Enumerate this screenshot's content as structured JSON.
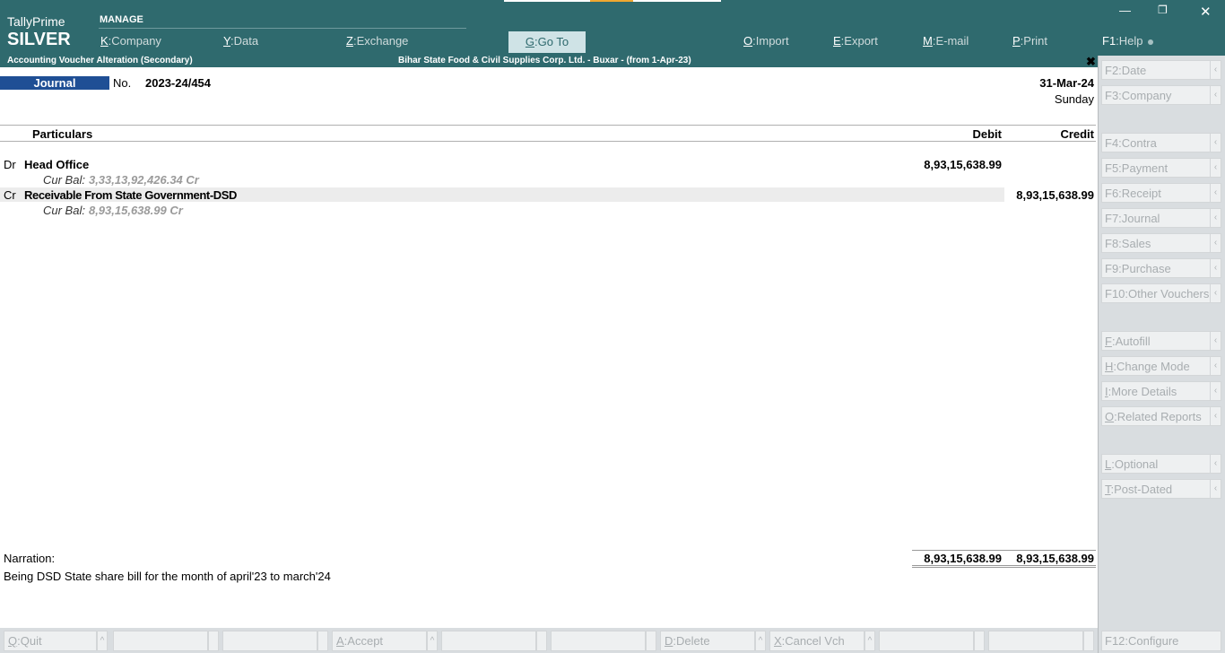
{
  "brand": {
    "name": "TallyPrime",
    "edition": "SILVER"
  },
  "menu": {
    "title": "MANAGE",
    "company": {
      "key": "K",
      "label": "Company"
    },
    "data": {
      "key": "Y",
      "label": "Data"
    },
    "exchange": {
      "key": "Z",
      "label": "Exchange"
    },
    "goto": {
      "key": "G",
      "label": "Go To"
    },
    "import": {
      "key": "O",
      "label": "Import"
    },
    "export": {
      "key": "E",
      "label": "Export"
    },
    "email": {
      "key": "M",
      "label": "E-mail"
    },
    "print": {
      "key": "P",
      "label": "Print"
    },
    "help": {
      "key": "F1",
      "label": "Help"
    }
  },
  "subtitle": {
    "screen": "Accounting Voucher Alteration (Secondary)",
    "company": "Bihar State Food & Civil Supplies Corp. Ltd. - Buxar - (from 1-Apr-23)"
  },
  "voucher": {
    "type": "Journal",
    "no_label": "No.",
    "no": "2023-24/454",
    "date": "31-Mar-24",
    "day": "Sunday"
  },
  "table": {
    "col_particulars": "Particulars",
    "col_debit": "Debit",
    "col_credit": "Credit",
    "bal_label": "Cur Bal:",
    "rows": [
      {
        "side": "Dr",
        "ledger": "Head Office",
        "amount": "8,93,15,638.99",
        "cur_bal": "3,33,13,92,426.34 Cr"
      },
      {
        "side": "Cr",
        "ledger": "Receivable From State Government-DSD",
        "amount": "8,93,15,638.99",
        "cur_bal": "8,93,15,638.99 Cr"
      }
    ]
  },
  "narration": {
    "label": "Narration:",
    "text": "Being DSD State share bill for the month of april'23 to march'24"
  },
  "totals": {
    "debit": "8,93,15,638.99",
    "credit": "8,93,15,638.99"
  },
  "right_panel": [
    {
      "key": "F2",
      "label": "Date"
    },
    {
      "key": "F3",
      "label": "Company"
    },
    {
      "key": "F4",
      "label": "Contra"
    },
    {
      "key": "F5",
      "label": "Payment"
    },
    {
      "key": "F6",
      "label": "Receipt"
    },
    {
      "key": "F7",
      "label": "Journal"
    },
    {
      "key": "F8",
      "label": "Sales"
    },
    {
      "key": "F9",
      "label": "Purchase"
    },
    {
      "key": "F10",
      "label": "Other Vouchers"
    },
    {
      "key": "F",
      "label": "Autofill"
    },
    {
      "key": "H",
      "label": "Change Mode"
    },
    {
      "key": "I",
      "label": "More Details"
    },
    {
      "key": "O",
      "label": "Related Reports"
    },
    {
      "key": "L",
      "label": "Optional"
    },
    {
      "key": "T",
      "label": "Post-Dated"
    }
  ],
  "bottom": {
    "quit": {
      "key": "Q",
      "label": "Quit"
    },
    "accept": {
      "key": "A",
      "label": "Accept"
    },
    "delete": {
      "key": "D",
      "label": "Delete"
    },
    "cancel": {
      "key": "X",
      "label": "Cancel Vch"
    },
    "configure": {
      "key": "F12",
      "label": "Configure"
    }
  },
  "icons": {
    "minimize": "minimize-icon",
    "restore": "restore-icon",
    "close": "close-icon",
    "collapse": "chevron-left-icon",
    "expand": "chevron-up-icon"
  },
  "colors": {
    "header": "#2f6a6e",
    "voucher_type": "#1f4f95",
    "panel": "#d9dde0",
    "topline_accent": "#f0a830"
  }
}
